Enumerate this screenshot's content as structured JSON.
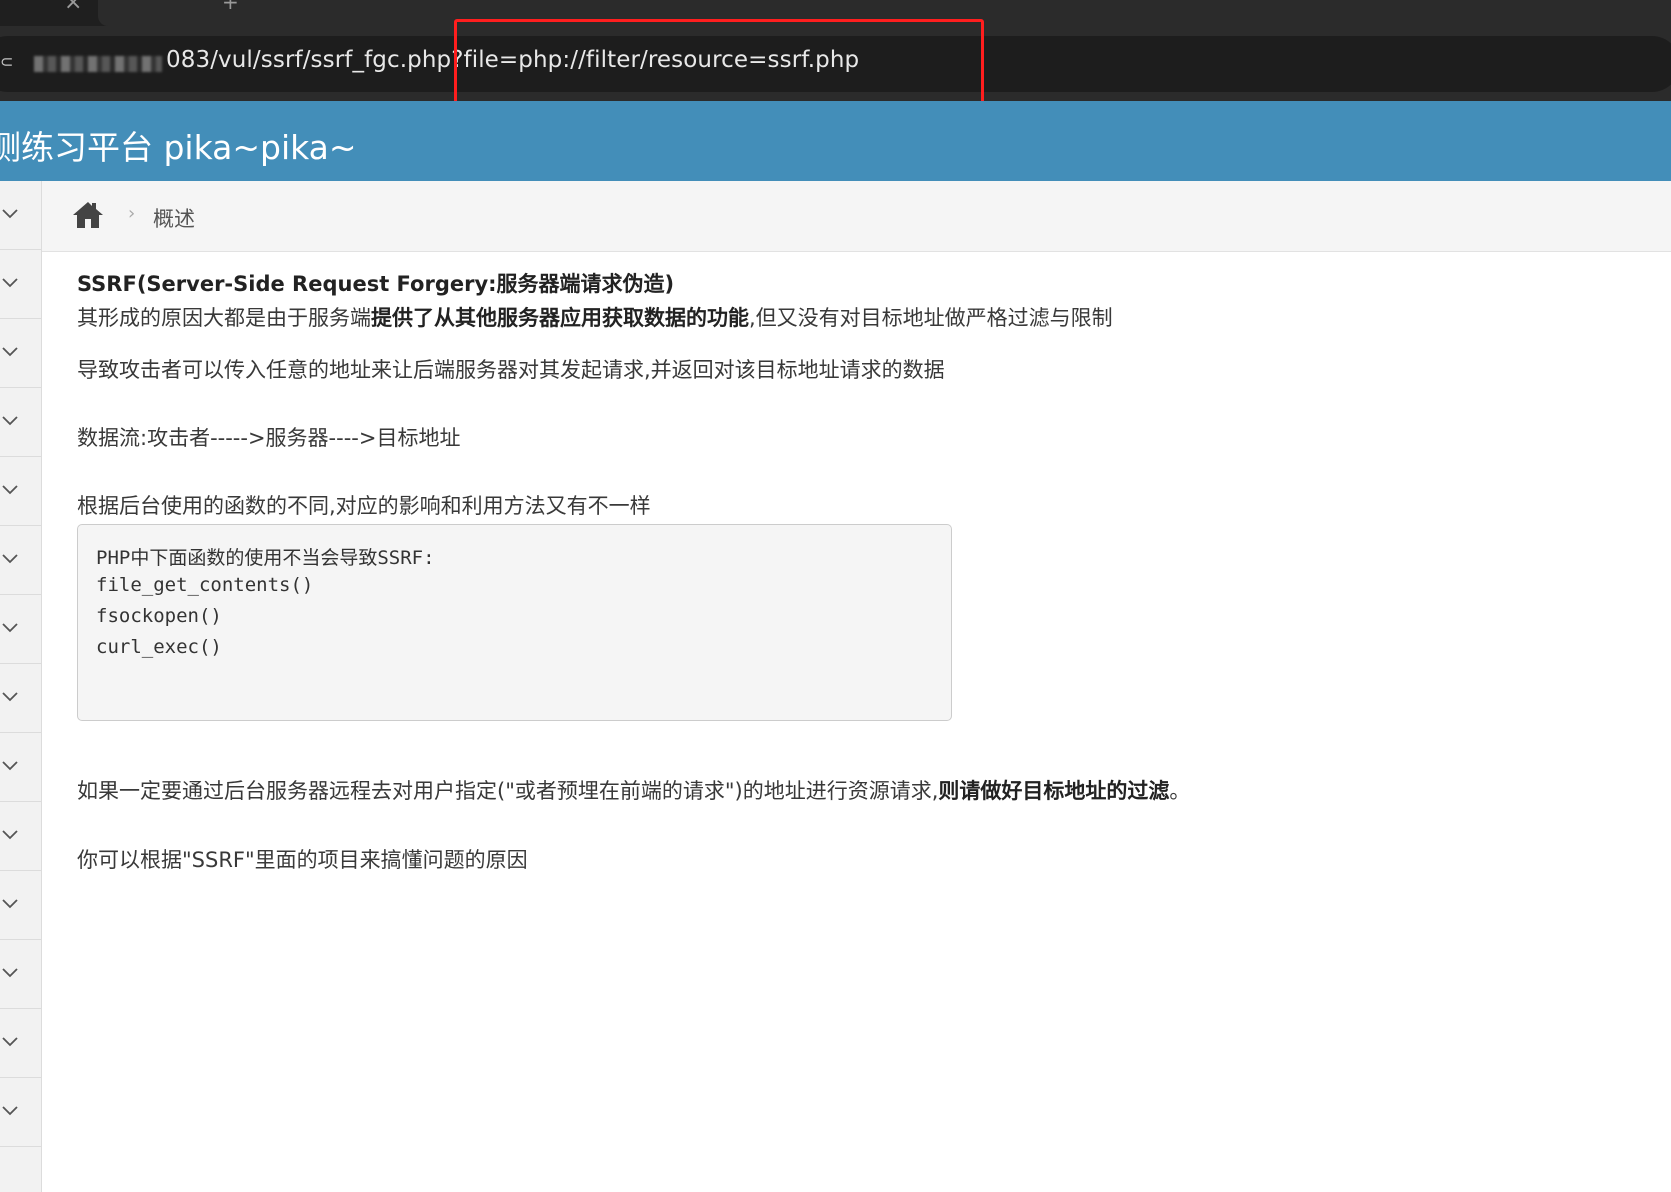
{
  "browser": {
    "tab_close_glyph": "×",
    "tab_mark_glyph": "+",
    "site_icon_glyph": "⊂",
    "url_visible": "083/vul/ssrf/ssrf_fgc.php?file=php://filter/resource=ssrf.php"
  },
  "header": {
    "title": "测练习平台 pika~pika~"
  },
  "sidebar": {
    "items": [
      {
        "icon": "chevron-down-icon"
      },
      {
        "icon": "chevron-down-icon"
      },
      {
        "icon": "chevron-down-icon"
      },
      {
        "icon": "chevron-down-icon"
      },
      {
        "icon": "chevron-down-icon"
      },
      {
        "icon": "chevron-down-icon"
      },
      {
        "icon": "chevron-down-icon"
      },
      {
        "icon": "chevron-down-icon"
      },
      {
        "icon": "chevron-down-icon"
      },
      {
        "icon": "chevron-down-icon"
      },
      {
        "icon": "chevron-down-icon"
      },
      {
        "icon": "chevron-down-icon"
      },
      {
        "icon": "chevron-down-icon"
      },
      {
        "icon": "chevron-down-icon"
      }
    ]
  },
  "breadcrumb": {
    "separator": "›",
    "current": "概述"
  },
  "main": {
    "heading": "SSRF(Server-Side Request Forgery:服务器端请求伪造)",
    "para1_pre": "其形成的原因大都是由于服务端",
    "para1_bold": "提供了从其他服务器应用获取数据的功能",
    "para1_post": ",但又没有对目标地址做严格过滤与限制",
    "para2": "导致攻击者可以传入任意的地址来让后端服务器对其发起请求,并返回对该目标地址请求的数据",
    "para3": "数据流:攻击者----->服务器---->目标地址",
    "para4": "根据后台使用的函数的不同,对应的影响和利用方法又有不一样",
    "code_lines": [
      "PHP中下面函数的使用不当会导致SSRF:",
      "file_get_contents()",
      "fsockopen()",
      "curl_exec()"
    ],
    "para5_pre": "如果一定要通过后台服务器远程去对用户指定(\"或者预埋在前端的请求\")的地址进行资源请求,",
    "para5_bold": "则请做好目标地址的过滤",
    "para5_post": "。",
    "para6": "你可以根据\"SSRF\"里面的项目来搞懂问题的原因"
  },
  "colors": {
    "header_bg": "#438eb9",
    "highlight_border": "#ff1e1e",
    "chrome_bg": "#2b2b2b"
  }
}
